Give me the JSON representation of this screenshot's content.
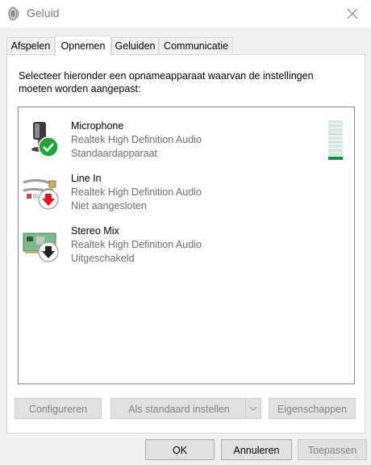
{
  "window": {
    "title": "Geluid",
    "app_icon": "speaker-icon",
    "close_icon": "close-icon"
  },
  "tabs": [
    {
      "label": "Afspelen"
    },
    {
      "label": "Opnemen",
      "active": true
    },
    {
      "label": "Geluiden"
    },
    {
      "label": "Communicatie"
    }
  ],
  "instruction": "Selecteer hieronder een opnameapparaat waarvan de instellingen moeten worden aangepast:",
  "devices": [
    {
      "name": "Microphone",
      "driver": "Realtek High Definition Audio",
      "status": "Standaardapparaat",
      "icon": "microphone-icon",
      "badge": "default-check-icon",
      "badge_color": "#22a33a"
    },
    {
      "name": "Line In",
      "driver": "Realtek High Definition Audio",
      "status": "Niet aangesloten",
      "icon": "line-in-cable-icon",
      "badge": "not-plugged-in-icon",
      "badge_color": "#e81123"
    },
    {
      "name": "Stereo Mix",
      "driver": "Realtek High Definition Audio",
      "status": "Uitgeschakeld",
      "icon": "sound-card-icon",
      "badge": "disabled-icon",
      "badge_color": "#222222"
    }
  ],
  "level_meter": {
    "level": 0.1,
    "color": "#0d8f45"
  },
  "panel_buttons": {
    "configure": "Configureren",
    "set_default": "Als standaard instellen",
    "properties": "Eigenschappen"
  },
  "dialog_buttons": {
    "ok": "OK",
    "cancel": "Annuleren",
    "apply": "Toepassen"
  }
}
